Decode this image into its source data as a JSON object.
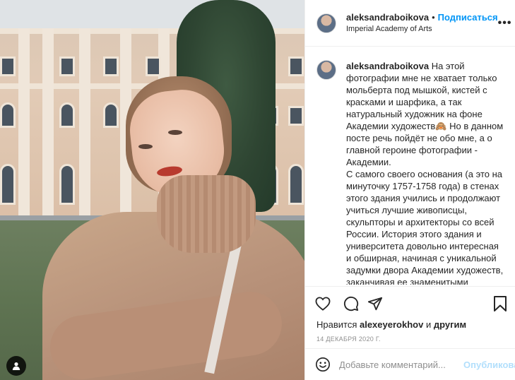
{
  "photo": {
    "alt": "",
    "tag_icon": "user-tag-icon"
  },
  "header": {
    "username": "aleksandraboikova",
    "separator": "•",
    "follow_label": "Подписаться",
    "location": "Imperial Academy of Arts",
    "more_icon": "more-horizontal-icon",
    "more_label": "•••"
  },
  "caption": {
    "username": "aleksandraboikova",
    "text": "На этой фотографии мне не хватает только мольберта под мышкой, кистей с красками и шарфика, а так натуральный художник на фоне Академии художеств🙈 Но в данном посте речь пойдёт не обо мне, а о главной героине фотографии - Академии.\nС самого своего основания (а это на минуточку 1757-1758 года) в стенах этого здания учились и продолжают учиться лучшие живописцы, скульпторы и архитекторы со всей России. История этого здания и университета довольно интересная и обширная, начиная с уникальной задумки двора Академии художеств, заканчивая ее знаменитыми выпускниками."
  },
  "actions": {
    "like_icon": "heart-icon",
    "comment_icon": "comment-icon",
    "share_icon": "share-icon",
    "save_icon": "bookmark-icon"
  },
  "likes": {
    "prefix": "Нравится ",
    "user": "alexeyerokhov",
    "suffix": " и ",
    "others": "другим"
  },
  "date": "14 декабря 2020 г.",
  "comment": {
    "emoji_icon": "smiley-icon",
    "placeholder": "Добавьте комментарий...",
    "publish_label": "Опубликовать"
  },
  "colors": {
    "accent": "#0095f6",
    "publish_disabled": "#b2dffc",
    "muted": "#8e8e8e",
    "text": "#262626"
  }
}
